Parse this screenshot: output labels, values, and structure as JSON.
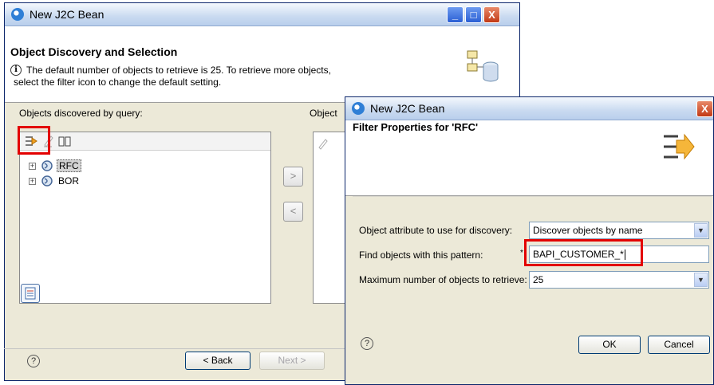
{
  "wizard": {
    "title": "New J2C Bean",
    "page_title": "Object Discovery and Selection",
    "description_line1": "The default number of objects to retrieve is 25.  To retrieve more objects,",
    "description_line2": "select the filter icon to change the default setting.",
    "discovered_label": "Objects discovered by query:",
    "selected_label": "Object",
    "tree_items": [
      {
        "label": "RFC",
        "selected": true
      },
      {
        "label": "BOR",
        "selected": false
      }
    ],
    "add_glyph": ">",
    "remove_glyph": "<",
    "back_label": "< Back",
    "next_label": "Next >",
    "help_glyph": "?"
  },
  "dialog": {
    "title": "New J2C Bean",
    "heading": "Filter Properties for 'RFC'",
    "fields": [
      {
        "label": "Object attribute to use for discovery:",
        "value": "Discover objects by name",
        "type": "select"
      },
      {
        "label": "Find objects with this pattern:",
        "value": "BAPI_CUSTOMER_*",
        "type": "text",
        "required_marker": "*"
      },
      {
        "label": "Maximum number of objects to retrieve:",
        "value": "25",
        "type": "select"
      }
    ],
    "ok_label": "OK",
    "cancel_label": "Cancel",
    "help_glyph": "?",
    "close_glyph": "X"
  },
  "window_controls": {
    "minimize": "_",
    "maximize": "□",
    "close": "X"
  },
  "colors": {
    "highlight": "#e30000",
    "title_gradient": "#c9daf0",
    "dialog_bg": "#ece9d8"
  }
}
